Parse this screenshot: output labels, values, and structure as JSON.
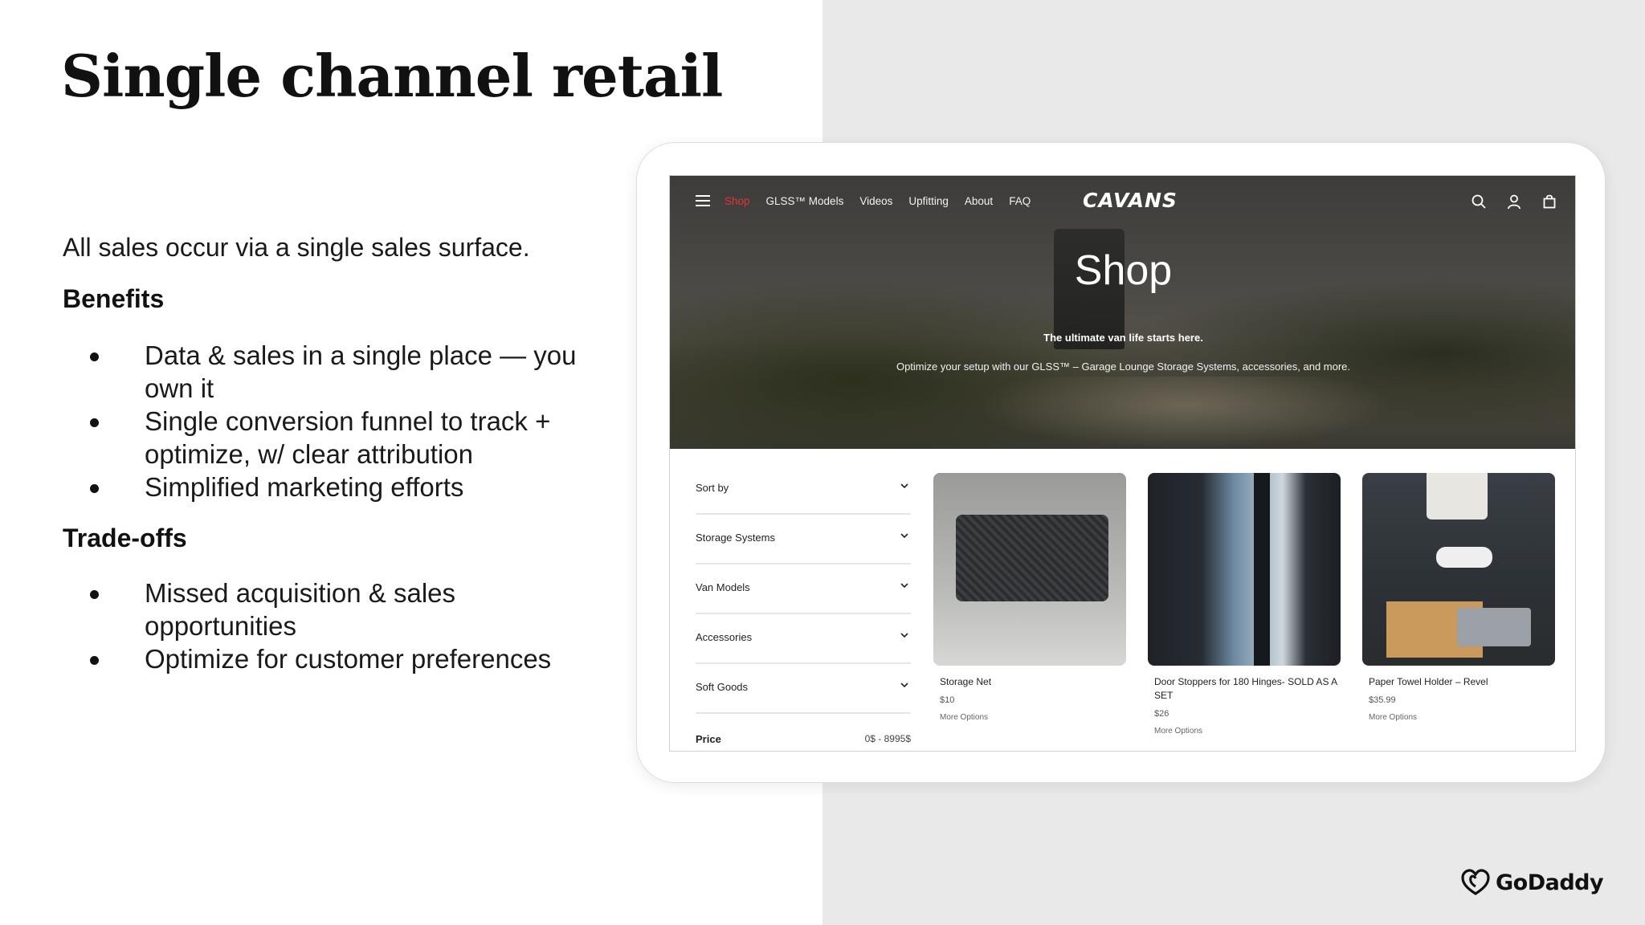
{
  "slide": {
    "title": "Single channel retail",
    "intro": "All sales occur via a single sales surface.",
    "benefits_heading": "Benefits",
    "benefits": [
      "Data & sales in a single place — you own it",
      "Single conversion funnel to track + optimize, w/ clear attribution",
      "Simplified marketing efforts"
    ],
    "tradeoffs_heading": "Trade-offs",
    "tradeoffs": [
      "Missed acquisition & sales opportunities",
      "Optimize for customer preferences"
    ]
  },
  "site": {
    "nav": {
      "links": [
        "Shop",
        "GLSS™ Models",
        "Videos",
        "Upfitting",
        "About",
        "FAQ"
      ],
      "active_link": "Shop",
      "logo": "CAVANS",
      "icons": [
        "search-icon",
        "account-icon",
        "cart-icon"
      ]
    },
    "hero": {
      "title": "Shop",
      "tagline": "The ultimate van life starts here.",
      "subtitle": "Optimize your setup with our GLSS™ – Garage Lounge Storage Systems, accessories, and more."
    },
    "filters": [
      {
        "label": "Sort by"
      },
      {
        "label": "Storage Systems"
      },
      {
        "label": "Van Models"
      },
      {
        "label": "Accessories"
      },
      {
        "label": "Soft Goods"
      }
    ],
    "price": {
      "label": "Price",
      "range": "0$ - 8995$"
    },
    "products": [
      {
        "name": "Storage Net",
        "price": "$10",
        "more": "More Options"
      },
      {
        "name": "Door Stoppers for 180 Hinges- SOLD AS A SET",
        "price": "$26",
        "more": "More Options"
      },
      {
        "name": "Paper Towel Holder – Revel",
        "price": "$35.99",
        "more": "More Options"
      }
    ]
  },
  "footer": {
    "brand": "GoDaddy"
  },
  "colors": {
    "active_nav": "#e03434",
    "right_panel": "#e9e9ea"
  }
}
